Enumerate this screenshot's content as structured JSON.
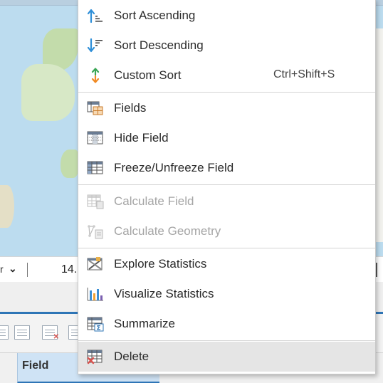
{
  "status_bar": {
    "coordinate_text": "14."
  },
  "table": {
    "header_field": "Field"
  },
  "context_menu": {
    "items": [
      {
        "label": "Sort Ascending",
        "icon": "sort-ascending-icon",
        "enabled": true
      },
      {
        "label": "Sort Descending",
        "icon": "sort-descending-icon",
        "enabled": true
      },
      {
        "label": "Custom Sort",
        "icon": "custom-sort-icon",
        "shortcut": "Ctrl+Shift+S",
        "enabled": true
      },
      {
        "label": "Fields",
        "icon": "fields-icon",
        "enabled": true
      },
      {
        "label": "Hide Field",
        "icon": "hide-field-icon",
        "enabled": true
      },
      {
        "label": "Freeze/Unfreeze Field",
        "icon": "freeze-field-icon",
        "enabled": true
      },
      {
        "label": "Calculate Field",
        "icon": "calculate-field-icon",
        "enabled": false
      },
      {
        "label": "Calculate Geometry",
        "icon": "calculate-geometry-icon",
        "enabled": false
      },
      {
        "label": "Explore Statistics",
        "icon": "explore-statistics-icon",
        "enabled": true
      },
      {
        "label": "Visualize Statistics",
        "icon": "visualize-statistics-icon",
        "enabled": true
      },
      {
        "label": "Summarize",
        "icon": "summarize-icon",
        "enabled": true
      },
      {
        "label": "Delete",
        "icon": "delete-icon",
        "enabled": true,
        "highlighted": true
      }
    ]
  },
  "colors": {
    "accent": "#2e75b6",
    "sort_blue": "#2f8fd8",
    "custom_sort_green": "#3aa655",
    "custom_sort_orange": "#f08a24",
    "delete_red": "#d9534f",
    "disabled_text": "#a5a5a5"
  }
}
